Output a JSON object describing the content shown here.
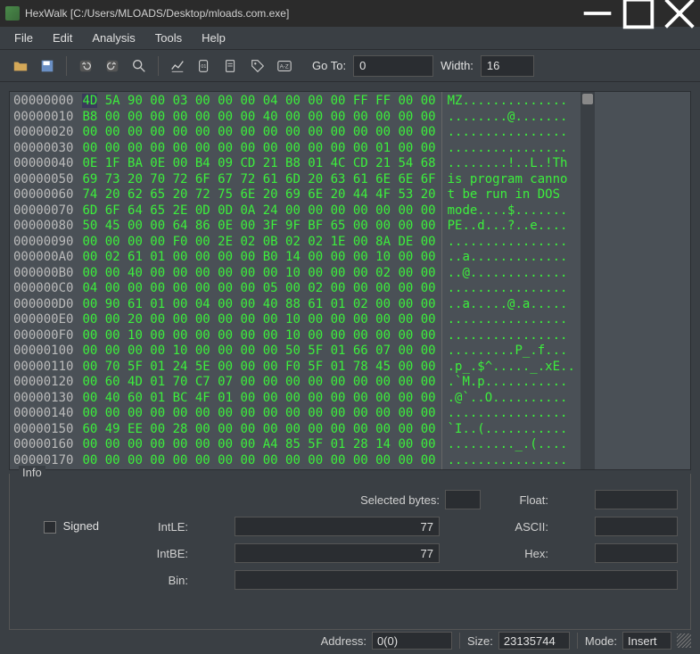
{
  "title": "HexWalk [C:/Users/MLOADS/Desktop/mloads.com.exe]",
  "menu": {
    "file": "File",
    "edit": "Edit",
    "analysis": "Analysis",
    "tools": "Tools",
    "help": "Help"
  },
  "toolbar": {
    "goto_label": "Go To:",
    "goto_value": "0",
    "width_label": "Width:",
    "width_value": "16"
  },
  "hex": {
    "offsets": [
      "00000000",
      "00000010",
      "00000020",
      "00000030",
      "00000040",
      "00000050",
      "00000060",
      "00000070",
      "00000080",
      "00000090",
      "000000A0",
      "000000B0",
      "000000C0",
      "000000D0",
      "000000E0",
      "000000F0",
      "00000100",
      "00000110",
      "00000120",
      "00000130",
      "00000140",
      "00000150",
      "00000160",
      "00000170"
    ],
    "rows": [
      "4D 5A 90 00 03 00 00 00 04 00 00 00 FF FF 00 00",
      "B8 00 00 00 00 00 00 00 40 00 00 00 00 00 00 00",
      "00 00 00 00 00 00 00 00 00 00 00 00 00 00 00 00",
      "00 00 00 00 00 00 00 00 00 00 00 00 00 01 00 00",
      "0E 1F BA 0E 00 B4 09 CD 21 B8 01 4C CD 21 54 68",
      "69 73 20 70 72 6F 67 72 61 6D 20 63 61 6E 6E 6F",
      "74 20 62 65 20 72 75 6E 20 69 6E 20 44 4F 53 20",
      "6D 6F 64 65 2E 0D 0D 0A 24 00 00 00 00 00 00 00",
      "50 45 00 00 64 86 0E 00 3F 9F BF 65 00 00 00 00",
      "00 00 00 00 F0 00 2E 02 0B 02 02 1E 00 8A DE 00",
      "00 02 61 01 00 00 00 00 B0 14 00 00 00 10 00 00",
      "00 00 40 00 00 00 00 00 00 10 00 00 00 02 00 00",
      "04 00 00 00 00 00 00 00 05 00 02 00 00 00 00 00",
      "00 90 61 01 00 04 00 00 40 88 61 01 02 00 00 00",
      "00 00 20 00 00 00 00 00 00 10 00 00 00 00 00 00",
      "00 00 10 00 00 00 00 00 00 10 00 00 00 00 00 00",
      "00 00 00 00 10 00 00 00 00 50 5F 01 66 07 00 00",
      "00 70 5F 01 24 5E 00 00 00 F0 5F 01 78 45 00 00",
      "00 60 4D 01 70 C7 07 00 00 00 00 00 00 00 00 00",
      "00 40 60 01 BC 4F 01 00 00 00 00 00 00 00 00 00",
      "00 00 00 00 00 00 00 00 00 00 00 00 00 00 00 00",
      "60 49 EE 00 28 00 00 00 00 00 00 00 00 00 00 00",
      "00 00 00 00 00 00 00 00 A4 85 5F 01 28 14 00 00",
      "00 00 00 00 00 00 00 00 00 00 00 00 00 00 00 00"
    ],
    "ascii": [
      "MZ..............",
      "........@.......",
      "................",
      "................",
      "........!..L.!Th",
      "is program canno",
      "t be run in DOS ",
      "mode....$.......",
      "PE..d...?..e....",
      "................",
      "..a.............",
      "..@.............",
      "................",
      "..a.....@.a.....",
      "................",
      "................",
      ".........P_.f...",
      ".p_.$^....._.xE..",
      ".`M.p...........",
      ".@`..O..........",
      "................",
      "`I..(...........",
      "........._.(....",
      "................"
    ]
  },
  "info": {
    "group_label": "Info",
    "selectedbytes_label": "Selected bytes:",
    "selectedbytes_value": "",
    "float_label": "Float:",
    "float_value": "",
    "signed_label": "Signed",
    "intle_label": "IntLE:",
    "intle_value": "77",
    "ascii_label": "ASCII:",
    "ascii_value": "",
    "intbe_label": "IntBE:",
    "intbe_value": "77",
    "hex_label": "Hex:",
    "hex_value": "",
    "bin_label": "Bin:",
    "bin_value": ""
  },
  "status": {
    "address_label": "Address:",
    "address_value": "0(0)",
    "size_label": "Size:",
    "size_value": "23135744",
    "mode_label": "Mode:",
    "mode_value": "Insert"
  }
}
